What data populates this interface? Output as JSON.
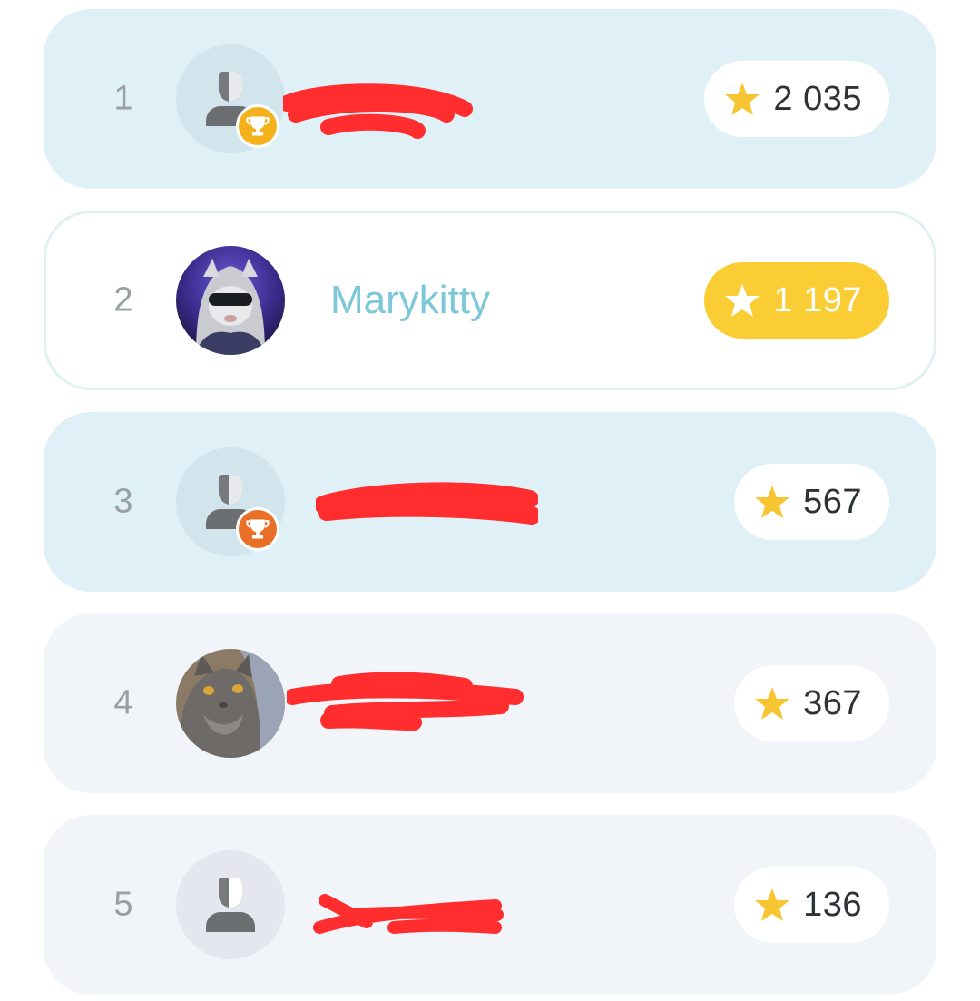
{
  "leaderboard": {
    "rows": [
      {
        "rank": "1",
        "name": "",
        "score": "2 035",
        "badge": "gold-trophy"
      },
      {
        "rank": "2",
        "name": "Marykitty",
        "score": "1 197",
        "highlight": "current-user"
      },
      {
        "rank": "3",
        "name": "",
        "score": "567",
        "badge": "bronze-trophy"
      },
      {
        "rank": "4",
        "name": "",
        "score": "367"
      },
      {
        "rank": "5",
        "name": "",
        "score": "136"
      }
    ]
  },
  "colors": {
    "row_top": "#dff1f7",
    "row_plain": "#f1f4f8",
    "highlight_pill": "#fbcd34",
    "username": "#7cc7d8",
    "star": "#f7c531",
    "redaction": "#ff2d2d"
  },
  "icons": [
    "person-icon",
    "trophy-icon",
    "star-icon",
    "cat-avatar"
  ]
}
